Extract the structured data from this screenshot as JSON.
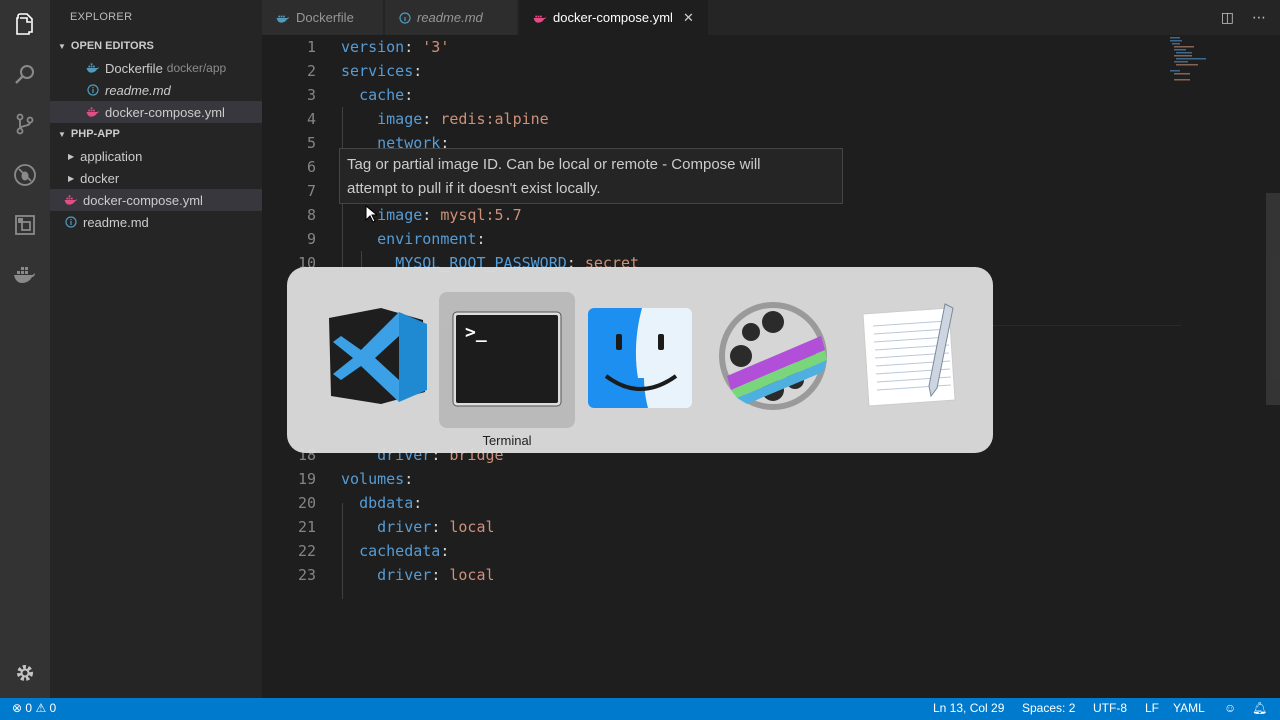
{
  "sidebar": {
    "title": "EXPLORER",
    "open_editors_label": "OPEN EDITORS",
    "open_editors": [
      {
        "name": "Dockerfile",
        "path": "docker/app",
        "icon": "docker-icon"
      },
      {
        "name": "readme.md",
        "icon": "info-icon"
      },
      {
        "name": "docker-compose.yml",
        "icon": "docker-icon"
      }
    ],
    "project_label": "PHP-APP",
    "tree": [
      {
        "name": "application",
        "type": "folder"
      },
      {
        "name": "docker",
        "type": "folder"
      },
      {
        "name": "docker-compose.yml",
        "type": "file"
      },
      {
        "name": "readme.md",
        "type": "file"
      }
    ]
  },
  "tabs": [
    {
      "label": "Dockerfile",
      "icon": "docker-icon"
    },
    {
      "label": "readme.md",
      "icon": "info-icon"
    },
    {
      "label": "docker-compose.yml",
      "icon": "docker-icon",
      "active": true
    }
  ],
  "editor": {
    "lines": [
      {
        "n": "1",
        "key": "version",
        "value": "'3'"
      },
      {
        "n": "2",
        "key": "services",
        "value": ""
      },
      {
        "n": "3",
        "key": "cache",
        "value": ""
      },
      {
        "n": "4",
        "key": "image",
        "value": "redis:alpine"
      },
      {
        "n": "5",
        "key": "network",
        "value": ""
      },
      {
        "n": "6"
      },
      {
        "n": "7"
      },
      {
        "n": "8",
        "key": "image",
        "value": "mysql:5.7"
      },
      {
        "n": "9",
        "key": "environment",
        "value": ""
      },
      {
        "n": "10",
        "key": "MYSQL_ROOT_PASSWORD",
        "value": "secret"
      },
      {
        "n": "18",
        "key": "driver",
        "value": "bridge"
      },
      {
        "n": "19",
        "key": "volumes",
        "value": ""
      },
      {
        "n": "20",
        "key": "dbdata",
        "value": ""
      },
      {
        "n": "21",
        "key": "driver",
        "value": "local"
      },
      {
        "n": "22",
        "key": "cachedata",
        "value": ""
      },
      {
        "n": "23",
        "key": "driver",
        "value": "local"
      }
    ],
    "hover_line1": "Tag or partial image ID. Can be local or remote - Compose will",
    "hover_line2": "attempt to pull if it doesn't exist locally."
  },
  "app_switcher": {
    "apps": [
      "Visual Studio Code",
      "Terminal",
      "Finder",
      "Final Cut",
      "TextEdit"
    ],
    "selected_label": "Terminal",
    "terminal_prompt": ">_"
  },
  "status": {
    "errors": "0",
    "warnings": "0",
    "position": "Ln 13, Col 29",
    "spaces": "Spaces: 2",
    "encoding": "UTF-8",
    "eol": "LF",
    "language": "YAML"
  },
  "colors": {
    "status_bar": "#007acc",
    "docker_pink": "#e44c85",
    "info_blue": "#519aba"
  }
}
